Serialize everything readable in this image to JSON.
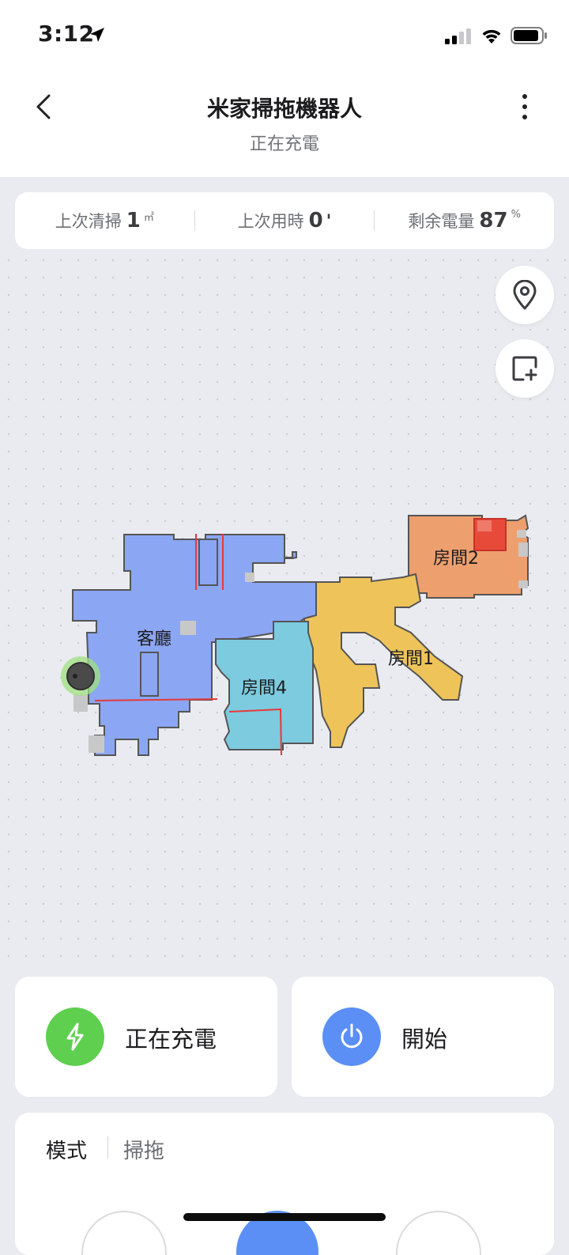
{
  "status_bar": {
    "time": "3:12"
  },
  "header": {
    "title": "米家掃拖機器人",
    "subtitle": "正在充電"
  },
  "stats": {
    "last_area": {
      "label": "上次清掃",
      "value": "1",
      "unit": "㎡"
    },
    "last_duration": {
      "label": "上次用時",
      "value": "0",
      "unit": "'"
    },
    "battery": {
      "label": "剩余電量",
      "value": "87",
      "unit": "%"
    }
  },
  "map": {
    "rooms": [
      "客廳",
      "房間4",
      "房間1",
      "房間2"
    ],
    "colors": {
      "living": "#8ba6f3",
      "room4": "#7ccbdf",
      "room1": "#eec45a",
      "room2": "#ee9f6e",
      "wall": "#4d4d4d",
      "barrier": "#e63a3a",
      "dock_ring": "#78d25a"
    }
  },
  "actions": {
    "charging_label": "正在充電",
    "start_label": "開始"
  },
  "mode": {
    "title": "模式",
    "value": "掃拖"
  },
  "colors": {
    "charging": "#5fcf4f",
    "start": "#5b8ff5"
  }
}
